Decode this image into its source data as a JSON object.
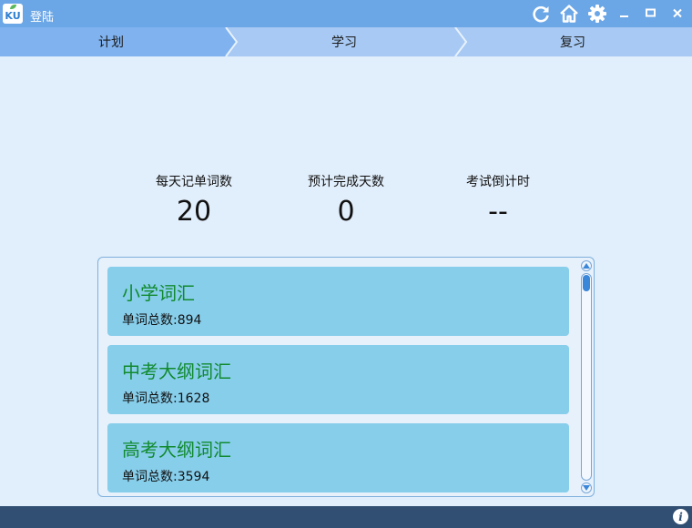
{
  "window": {
    "title": "登陆",
    "logo_text": "KU",
    "controls": [
      "refresh-icon",
      "home-icon",
      "gear-icon",
      "minimize-icon",
      "maximize-icon",
      "close-icon"
    ],
    "accent_color": "#6ba6e6"
  },
  "steps": [
    {
      "label": "计划",
      "active": true
    },
    {
      "label": "学习",
      "active": false
    },
    {
      "label": "复习",
      "active": false
    }
  ],
  "stats": [
    {
      "label": "每天记单词数",
      "value": "20"
    },
    {
      "label": "预计完成天数",
      "value": "0"
    },
    {
      "label": "考试倒计时",
      "value": "--"
    }
  ],
  "books": [
    {
      "name": "小学词汇",
      "count": "单词总数:894"
    },
    {
      "name": "中考大纲词汇",
      "count": "单词总数:1628"
    },
    {
      "name": "高考大纲词汇",
      "count": "单词总数:3594"
    }
  ],
  "statusbar": {
    "info_icon": "info-icon",
    "info_glyph": "i",
    "color": "#304f72"
  }
}
